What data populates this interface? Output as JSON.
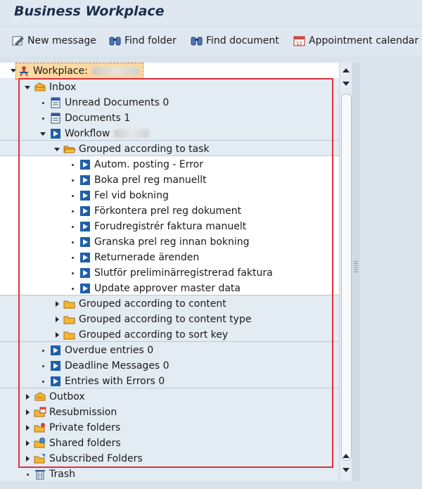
{
  "app_title": "Business Workplace",
  "toolbar": {
    "new_message": "New message",
    "find_folder": "Find folder",
    "find_document": "Find document",
    "appointment_calendar": "Appointment calendar"
  },
  "tree": {
    "root_label": "Workplace:",
    "inbox": "Inbox",
    "unread_documents": "Unread Documents 0",
    "documents": "Documents 1",
    "workflow": "Workflow",
    "grouped_task": "Grouped according to task",
    "tasks": [
      "Autom. posting - Error",
      "Boka prel reg manuellt",
      "Fel vid bokning",
      "Förkontera prel reg dokument",
      "Forudregistrér faktura manuelt",
      "Granska prel reg innan bokning",
      "Returnerade ärenden",
      "Slutför preliminärregistrerad faktura",
      "Update approver master data"
    ],
    "grouped_content": "Grouped according to content",
    "grouped_content_type": "Grouped according to content type",
    "grouped_sort_key": "Grouped according to sort key",
    "overdue_entries": "Overdue entries 0",
    "deadline_messages": "Deadline Messages 0",
    "entries_with_errors": "Entries with Errors 0",
    "outbox": "Outbox",
    "resubmission": "Resubmission",
    "private_folders": "Private folders",
    "shared_folders": "Shared folders",
    "subscribed_folders": "Subscribed Folders",
    "trash": "Trash"
  },
  "colors": {
    "highlight_border": "#e0303c",
    "selection_fill": "#fcd9a1",
    "task_icon_blue": "#1f5fa8",
    "folder_yellow": "#f5b731"
  },
  "icons": [
    "pencil-note-icon",
    "binoculars-icon",
    "calendar-icon",
    "workplace-person-icon",
    "inbox-folder-icon",
    "document-icon",
    "workflow-play-icon",
    "folder-open-icon",
    "folder-icon",
    "outbox-icon",
    "resubmission-icon",
    "private-folder-icon",
    "shared-folder-icon",
    "subscribed-folder-icon",
    "trash-icon"
  ]
}
